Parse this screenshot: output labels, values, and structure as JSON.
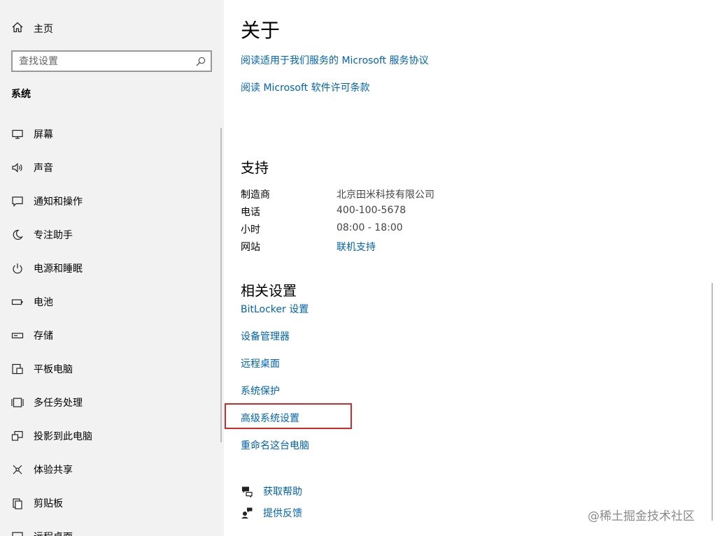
{
  "sidebar": {
    "home_label": "主页",
    "search_placeholder": "查找设置",
    "section_title": "系统",
    "items": [
      {
        "label": "屏幕",
        "icon": "monitor-icon"
      },
      {
        "label": "声音",
        "icon": "speaker-icon"
      },
      {
        "label": "通知和操作",
        "icon": "notification-icon"
      },
      {
        "label": "专注助手",
        "icon": "moon-icon"
      },
      {
        "label": "电源和睡眠",
        "icon": "power-icon"
      },
      {
        "label": "电池",
        "icon": "battery-icon"
      },
      {
        "label": "存储",
        "icon": "storage-icon"
      },
      {
        "label": "平板电脑",
        "icon": "tablet-icon"
      },
      {
        "label": "多任务处理",
        "icon": "multitasking-icon"
      },
      {
        "label": "投影到此电脑",
        "icon": "projection-icon"
      },
      {
        "label": "体验共享",
        "icon": "share-icon"
      },
      {
        "label": "剪贴板",
        "icon": "clipboard-icon"
      },
      {
        "label": "远程桌面",
        "icon": "remote-desktop-icon"
      }
    ]
  },
  "main": {
    "title": "关于",
    "agreement_links": [
      "阅读适用于我们服务的 Microsoft 服务协议",
      "阅读 Microsoft 软件许可条款"
    ],
    "support": {
      "heading": "支持",
      "rows": [
        {
          "key": "制造商",
          "value": "北京田米科技有限公司"
        },
        {
          "key": "电话",
          "value": "400-100-5678"
        },
        {
          "key": "小时",
          "value": "08:00 - 18:00"
        },
        {
          "key": "网站",
          "value": "联机支持"
        }
      ]
    },
    "related": {
      "heading": "相关设置",
      "links": [
        "BitLocker 设置",
        "设备管理器",
        "远程桌面",
        "系统保护",
        "高级系统设置",
        "重命名这台电脑"
      ]
    },
    "help": {
      "get_help": "获取帮助",
      "feedback": "提供反馈"
    }
  },
  "watermark": "@稀土掘金技术社区",
  "colors": {
    "link": "#0063b1",
    "sidebar_bg": "#f2f2f2",
    "highlight": "#d4282c"
  }
}
